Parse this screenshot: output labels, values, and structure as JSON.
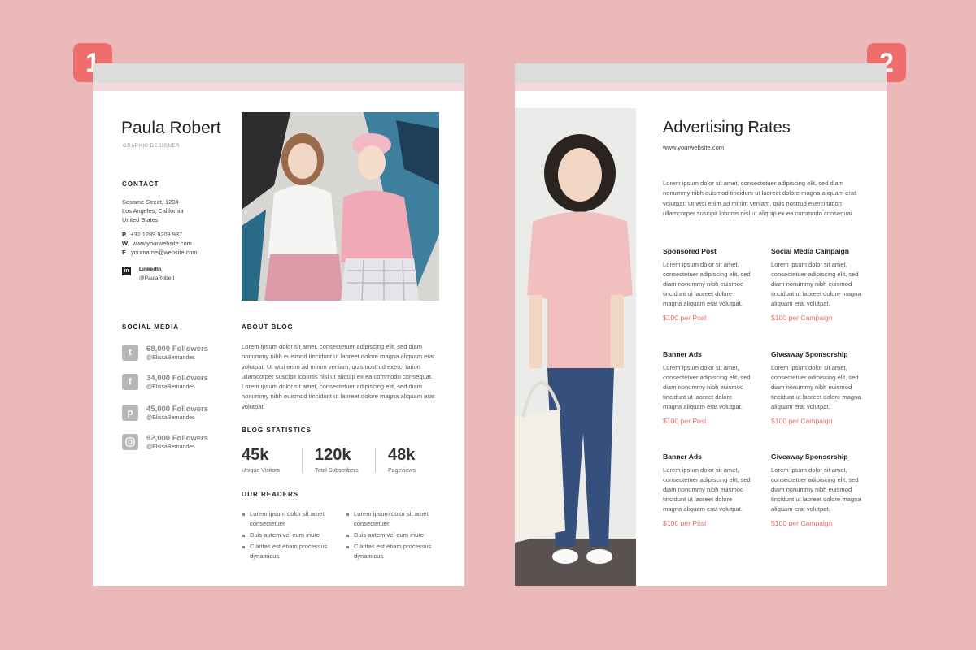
{
  "badges": [
    "1",
    "2"
  ],
  "page1": {
    "name": "Paula Robert",
    "role": "GRAPHIC DESIGNER",
    "contact": {
      "heading": "CONTACT",
      "address": [
        "Sesame Street, 1234",
        "Los Angeles, California",
        "United States"
      ],
      "phone_label": "P.",
      "phone": "+32 1289 9209 987",
      "web_label": "W.",
      "web": "www.yourwebsite.com",
      "email_label": "E.",
      "email": "yourname@website.com",
      "linkedin_label": "LinkedIn",
      "linkedin_handle": "@PaulaRobert"
    },
    "social": {
      "heading": "SOCIAL MEDIA",
      "items": [
        {
          "icon": "twitter-icon",
          "count": "68,000 Followers",
          "handle": "@ElissaBernandes"
        },
        {
          "icon": "facebook-icon",
          "count": "34,000 Followers",
          "handle": "@ElissaBernandes"
        },
        {
          "icon": "pinterest-icon",
          "count": "45,000 Followers",
          "handle": "@ElissaBernandes"
        },
        {
          "icon": "instagram-icon",
          "count": "92,000 Followers",
          "handle": "@ElissaBernandes"
        }
      ]
    },
    "about": {
      "heading": "ABOUT BLOG",
      "text": "Lorem ipsum dolor sit amet, consectetuer adipiscing elit, sed diam nonummy nibh euismod tincidunt ut laoreet dolore magna aliquam erat volutpat. Ut wisi enim ad minim veniam, quis nostrud exerci tation ullamcorper suscipit lobortis nisl ut aliquip ex ea commodo consequat.  Lorem ipsum dolor sit amet, consectetuer adipiscing elit, sed diam nonummy nibh euismod tincidunt ut laoreet dolore magna aliquam erat volutpat."
    },
    "stats": {
      "heading": "BLOG STATISTICS",
      "items": [
        {
          "value": "45k",
          "label": "Unique Visitors"
        },
        {
          "value": "120k",
          "label": "Total Subscribers"
        },
        {
          "value": "48k",
          "label": "Pageviews"
        }
      ]
    },
    "readers": {
      "heading": "OUR READERS",
      "col1": [
        "Lorem ipsum dolor sit amet consectetuer",
        "Duis autem vel eum iriure",
        "Claritas est etiam processus dynamicus"
      ],
      "col2": [
        "Lorem ipsum dolor sit amet consectetuer",
        "Duis autem vel eum iriure",
        "Claritas est etiam processus dynamicus"
      ]
    }
  },
  "page2": {
    "title": "Advertising Rates",
    "website": "www.yourwebsite.com",
    "intro": "Lorem ipsum dolor sit amet, consectetuer adipiscing elit, sed diam nonummy nibh euismod tincidunt ut laoreet dolore magna aliquam erat volutpat. Ut wisi enim ad minim veniam, quis nostrud exerci tation ullamcorper suscipit lobortis nisl ut aliquip ex ea commodo consequat",
    "rates": [
      {
        "title": "Sponsored Post",
        "body": "Lorem ipsum dolor sit amet, consectetuer adipiscing elit, sed diam nonummy nibh euismod tincidunt ut laoreet dolore magna aliquam erat volutpat.",
        "price": "$100 per Post"
      },
      {
        "title": "Social Media Campaign",
        "body": "Lorem ipsum dolor sit amet, consectetuer adipiscing elit, sed diam nonummy nibh euismod tincidunt ut laoreet dolore magna aliquam erat volutpat.",
        "price": "$100 per Campaign"
      },
      {
        "title": "Banner Ads",
        "body": "Lorem ipsum dolor sit amet, consectetuer adipiscing elit, sed diam nonummy nibh euismod tincidunt ut laoreet dolore magna aliquam erat volutpat.",
        "price": "$100 per Post"
      },
      {
        "title": "Giveaway Sponsorship",
        "body": "Lorem ipsum dolor sit amet, consectetuer adipiscing elit, sed diam nonummy nibh euismod tincidunt ut laoreet dolore magna aliquam erat volutpat.",
        "price": "$100 per Campaign"
      },
      {
        "title": "Banner Ads",
        "body": "Lorem ipsum dolor sit amet, consectetuer adipiscing elit, sed diam nonummy nibh euismod tincidunt ut laoreet dolore magna aliquam erat volutpat.",
        "price": "$100 per Post"
      },
      {
        "title": "Giveaway Sponsorship",
        "body": "Lorem ipsum dolor sit amet, consectetuer adipiscing elit, sed diam nonummy nibh euismod tincidunt ut laoreet dolore magna aliquam erat volutpat.",
        "price": "$100 per Campaign"
      }
    ]
  },
  "colors": {
    "background": "#ebb9ba",
    "badge": "#ee6e6d",
    "accent": "#e56e6b"
  }
}
